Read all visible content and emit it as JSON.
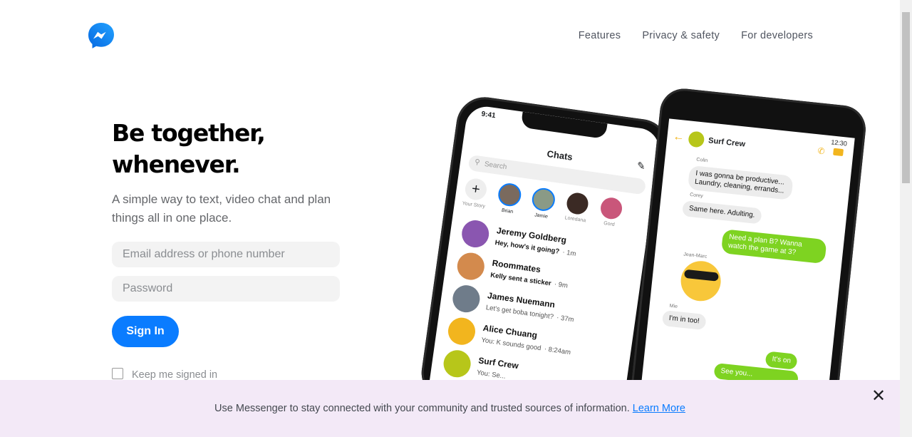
{
  "nav": {
    "items": [
      "Features",
      "Privacy & safety",
      "For developers"
    ]
  },
  "hero": {
    "title_line1": "Be together,",
    "title_line2": "whenever.",
    "subtitle": "A simple way to text, video chat and plan things all in one place."
  },
  "login": {
    "email_placeholder": "Email address or phone number",
    "password_placeholder": "Password",
    "signin_label": "Sign In",
    "keep_label": "Keep me signed in"
  },
  "phone_left": {
    "time": "9:41",
    "header": "Chats",
    "search_placeholder": "Search",
    "stories": [
      "Your Story",
      "Brian",
      "Jamie",
      "Loredana",
      "Gord"
    ],
    "chats": [
      {
        "name": "Jeremy Goldberg",
        "msg": "Hey, how's it going?",
        "time": "· 1m"
      },
      {
        "name": "Roommates",
        "msg": "Kelly sent a sticker",
        "time": "· 9m"
      },
      {
        "name": "James Nuemann",
        "msg": "Let's get boba tonight?",
        "time": "· 37m"
      },
      {
        "name": "Alice Chuang",
        "msg": "You: K sounds good",
        "time": "· 8:24am"
      },
      {
        "name": "Surf Crew",
        "msg": "You: Se...",
        "time": ""
      }
    ]
  },
  "phone_right": {
    "time": "12:30",
    "group": "Surf Crew",
    "messages": [
      {
        "sender": "Colin",
        "text": "I was gonna be productive... Laundry, cleaning, errands..."
      },
      {
        "sender": "Corey",
        "text": "Same here. Adulting."
      },
      {
        "sender": "",
        "text": "Need a plan B? Wanna watch the game at 3?"
      },
      {
        "sender": "Jean-Marc",
        "text": ""
      },
      {
        "sender": "Mie",
        "text": "I'm in too!"
      },
      {
        "sender": "",
        "text": "It's on"
      },
      {
        "sender": "",
        "text": "See you..."
      }
    ]
  },
  "banner": {
    "text": "Use Messenger to stay connected with your community and trusted sources of information.",
    "link": "Learn More"
  },
  "colors": {
    "brand": "#0a7cff",
    "banner_bg": "#f3e9f7",
    "bubble_green": "#7ed321"
  }
}
